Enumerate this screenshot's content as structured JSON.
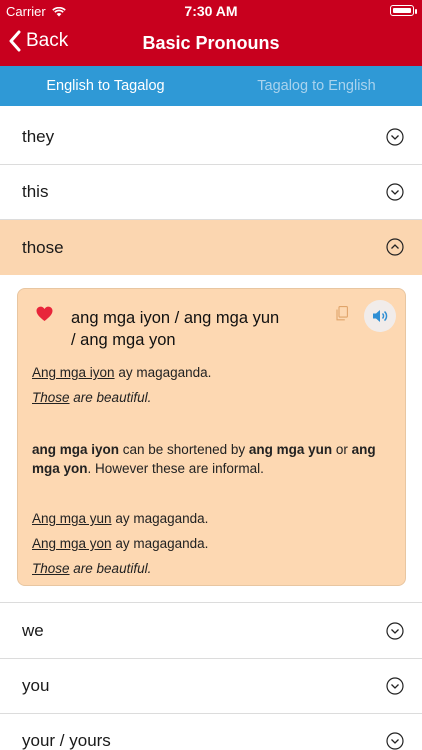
{
  "status_bar": {
    "carrier": "Carrier",
    "time": "7:30 AM"
  },
  "nav": {
    "back_label": "Back",
    "title": "Basic Pronouns"
  },
  "tabs": [
    {
      "label": "English to Tagalog",
      "active": true
    },
    {
      "label": "Tagalog to English",
      "active": false
    }
  ],
  "items_before": [
    "they",
    "this"
  ],
  "expanded_item": "those",
  "detail": {
    "headword_line1": "ang mga iyon / ang mga yun",
    "headword_line2": "/ ang mga yon",
    "example1_tl_u": "Ang mga iyon",
    "example1_tl_rest": " ay magaganda.",
    "example1_en_u": "Those",
    "example1_en_rest": " are beautiful.",
    "note_b1": "ang mga iyon",
    "note_t1": " can be shortened by ",
    "note_b2": "ang mga yun",
    "note_t2": " or ",
    "note_b3": "ang mga yon",
    "note_t3": ". However these are informal.",
    "example2_tl_u": "Ang mga yun",
    "example2_tl_rest": " ay magaganda.",
    "example3_tl_u": "Ang mga yon",
    "example3_tl_rest": " ay magaganda.",
    "example3_en_u": "Those",
    "example3_en_rest": " are beautiful."
  },
  "items_after": [
    "we",
    "you",
    "your / yours"
  ],
  "icons": {
    "heart": "heart-icon",
    "copy": "copy-icon",
    "speaker": "speaker-icon",
    "chevron_down": "chevron-down-circle-icon",
    "chevron_up": "chevron-up-circle-icon"
  },
  "colors": {
    "header_red": "#c8001e",
    "tab_blue": "#2f99d6",
    "highlight": "#fbd6b0",
    "heart_red": "#e8253a",
    "speaker_blue": "#2f8fd4"
  }
}
